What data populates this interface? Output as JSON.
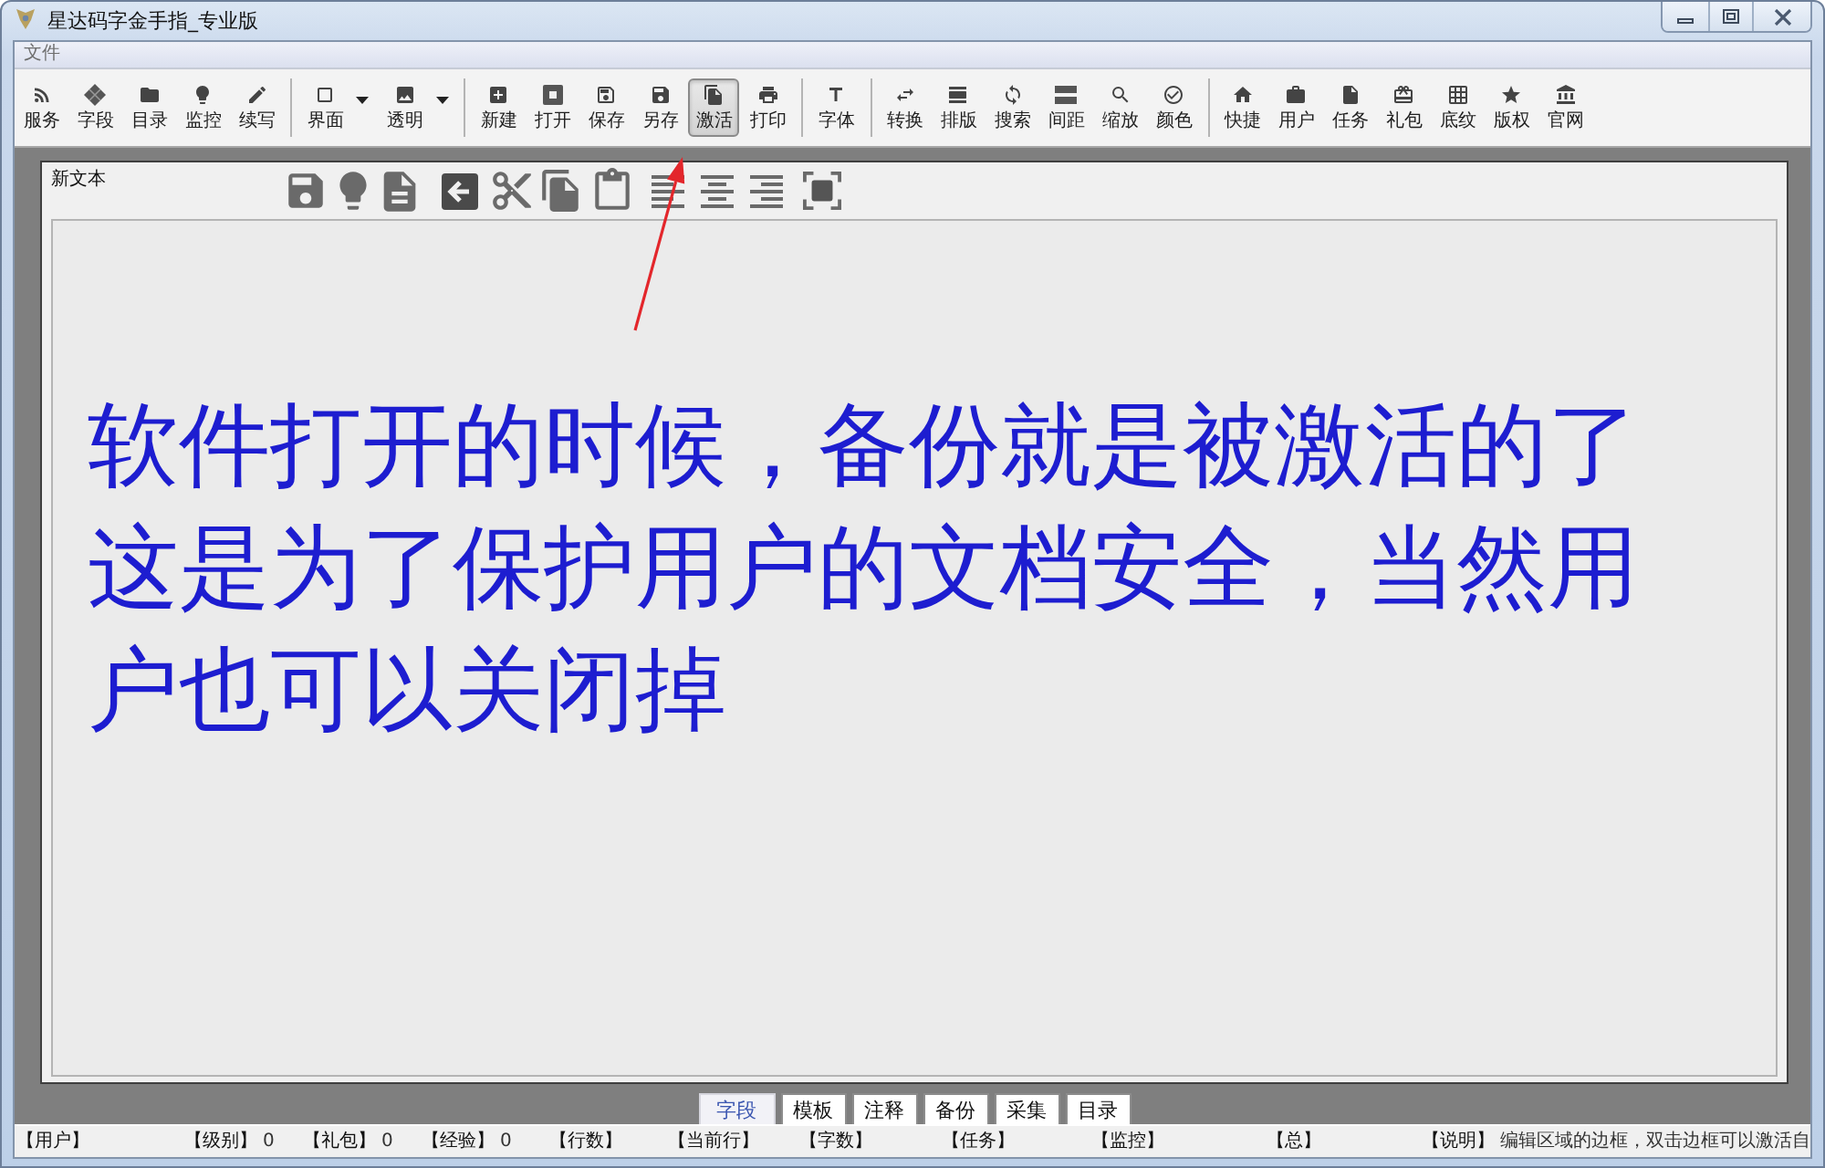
{
  "window": {
    "title": "星达码字金手指_专业版"
  },
  "menu": [
    {
      "label": "文件"
    }
  ],
  "toolbar": {
    "groups": [
      {
        "items": [
          {
            "label": "服务",
            "kind": "button",
            "pressed": false
          },
          {
            "label": "字段",
            "kind": "button",
            "pressed": false
          },
          {
            "label": "目录",
            "kind": "button",
            "pressed": false
          },
          {
            "label": "监控",
            "kind": "button",
            "pressed": false
          },
          {
            "label": "续写",
            "kind": "button",
            "pressed": false
          }
        ]
      },
      {
        "items": [
          {
            "label": "界面",
            "kind": "dropdown",
            "pressed": false
          },
          {
            "label": "透明",
            "kind": "dropdown",
            "pressed": false
          }
        ]
      },
      {
        "items": [
          {
            "label": "新建",
            "kind": "button",
            "pressed": false
          },
          {
            "label": "打开",
            "kind": "button",
            "pressed": false
          },
          {
            "label": "保存",
            "kind": "button",
            "pressed": false
          },
          {
            "label": "另存",
            "kind": "button",
            "pressed": false
          },
          {
            "label": "激活",
            "kind": "button",
            "pressed": true
          },
          {
            "label": "打印",
            "kind": "button",
            "pressed": false
          }
        ]
      },
      {
        "items": [
          {
            "label": "字体",
            "kind": "button",
            "pressed": false
          }
        ]
      },
      {
        "items": [
          {
            "label": "转换",
            "kind": "button",
            "pressed": false
          },
          {
            "label": "排版",
            "kind": "button",
            "pressed": false
          },
          {
            "label": "搜索",
            "kind": "button",
            "pressed": false
          },
          {
            "label": "间距",
            "kind": "button",
            "pressed": false
          },
          {
            "label": "缩放",
            "kind": "button",
            "pressed": false
          },
          {
            "label": "颜色",
            "kind": "button",
            "pressed": false
          }
        ]
      },
      {
        "items": [
          {
            "label": "快捷",
            "kind": "button",
            "pressed": false
          },
          {
            "label": "用户",
            "kind": "button",
            "pressed": false
          },
          {
            "label": "任务",
            "kind": "button",
            "pressed": false
          },
          {
            "label": "礼包",
            "kind": "button",
            "pressed": false
          },
          {
            "label": "底纹",
            "kind": "button",
            "pressed": false
          },
          {
            "label": "版权",
            "kind": "button",
            "pressed": false
          },
          {
            "label": "官网",
            "kind": "button",
            "pressed": false
          }
        ]
      }
    ]
  },
  "document": {
    "title": "新文本",
    "text": "软件打开的时候，备份就是被激活的了这是为了保护用户的文档安全，当然用户也可以关闭掉"
  },
  "tabs": [
    {
      "label": "字段",
      "selected": true
    },
    {
      "label": "模板",
      "selected": false
    },
    {
      "label": "注释",
      "selected": false
    },
    {
      "label": "备份",
      "selected": false
    },
    {
      "label": "采集",
      "selected": false
    },
    {
      "label": "目录",
      "selected": false
    }
  ],
  "status_bar": [
    {
      "label": "【用户】"
    },
    {
      "label": "【级别】",
      "value": "0"
    },
    {
      "label": "【礼包】",
      "value": "0"
    },
    {
      "label": "【经验】",
      "value": "0"
    },
    {
      "label": "【行数】"
    },
    {
      "label": "【当前行】"
    },
    {
      "label": "【字数】"
    },
    {
      "label": "【任务】"
    },
    {
      "label": "【监控】"
    },
    {
      "label": "【总】"
    },
    {
      "label": "【说明】",
      "value": "编辑区域的边框，双击边框可以激活自"
    }
  ]
}
